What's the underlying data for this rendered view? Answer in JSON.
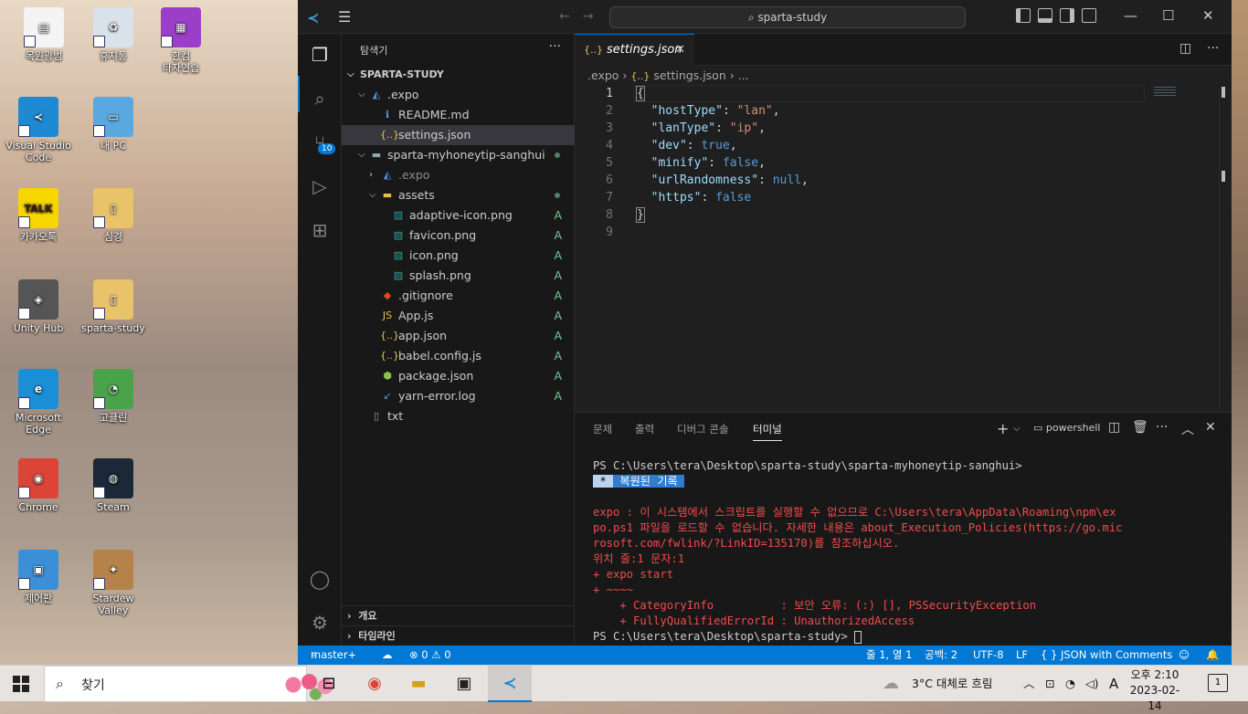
{
  "desktop": {
    "icons": [
      {
        "label": "목원광범",
        "glyph": "▤",
        "color": "#f4f4f4"
      },
      {
        "label": "휴지통",
        "glyph": "♻",
        "color": "#d9e2ea"
      },
      {
        "label": "한컴\n타자연습",
        "glyph": "▦",
        "color": "#9b3fc9"
      },
      {
        "label": "Visual Studio\nCode",
        "glyph": "≺",
        "color": "#1f8ad2"
      },
      {
        "label": "내 PC",
        "glyph": "▭",
        "color": "#5aa8e0"
      },
      {
        "label": "카카오톡",
        "glyph": "TALK",
        "color": "#f7d600"
      },
      {
        "label": "심경",
        "glyph": "▯",
        "color": "#e8c36a"
      },
      {
        "label": "Unity Hub",
        "glyph": "◈",
        "color": "#555"
      },
      {
        "label": "sparta-study",
        "glyph": "▯",
        "color": "#e8c36a"
      },
      {
        "label": "Microsoft\nEdge",
        "glyph": "e",
        "color": "#1b8fd6"
      },
      {
        "label": "고클린",
        "glyph": "◔",
        "color": "#4aa24a"
      },
      {
        "label": "Chrome",
        "glyph": "◉",
        "color": "#db4437"
      },
      {
        "label": "Steam",
        "glyph": "◍",
        "color": "#1b2838"
      },
      {
        "label": "제어판",
        "glyph": "▣",
        "color": "#3a8fd6"
      },
      {
        "label": "Stardew\nValley",
        "glyph": "✦",
        "color": "#b5824a"
      }
    ]
  },
  "titlebar": {
    "search": "sparta-study"
  },
  "activity": {
    "scm_badge": "10"
  },
  "sidebar": {
    "title": "탐색기",
    "more": "···",
    "root": "SPARTA-STUDY",
    "tree": [
      {
        "name": ".expo",
        "type": "folder-open",
        "icon": "◭",
        "icon_color": "#4a90d9",
        "depth": 1,
        "status": ""
      },
      {
        "name": "README.md",
        "type": "file",
        "icon": "ℹ",
        "icon_color": "#4aa3df",
        "depth": 2,
        "status": ""
      },
      {
        "name": "settings.json",
        "type": "file",
        "icon": "{..}",
        "icon_color": "#e8c14c",
        "depth": 2,
        "status": "",
        "selected": true
      },
      {
        "name": "sparta-myhoneytip-sanghui",
        "type": "folder-open",
        "icon": "▬",
        "icon_color": "#90a4ae",
        "depth": 1,
        "status": "dot"
      },
      {
        "name": ".expo",
        "type": "folder-closed",
        "icon": "◭",
        "icon_color": "#4a90d9",
        "depth": 2,
        "status": "",
        "dim": true
      },
      {
        "name": "assets",
        "type": "folder-open",
        "icon": "▬",
        "icon_color": "#e8c14c",
        "depth": 2,
        "status": "dot"
      },
      {
        "name": "adaptive-icon.png",
        "type": "file",
        "icon": "▨",
        "icon_color": "#26a69a",
        "depth": 3,
        "status": "A"
      },
      {
        "name": "favicon.png",
        "type": "file",
        "icon": "▨",
        "icon_color": "#26a69a",
        "depth": 3,
        "status": "A"
      },
      {
        "name": "icon.png",
        "type": "file",
        "icon": "▨",
        "icon_color": "#26a69a",
        "depth": 3,
        "status": "A"
      },
      {
        "name": "splash.png",
        "type": "file",
        "icon": "▨",
        "icon_color": "#26a69a",
        "depth": 3,
        "status": "A"
      },
      {
        "name": ".gitignore",
        "type": "file",
        "icon": "◆",
        "icon_color": "#e64a19",
        "depth": 2,
        "status": "A"
      },
      {
        "name": "App.js",
        "type": "file",
        "icon": "JS",
        "icon_color": "#e8c14c",
        "depth": 2,
        "status": "A"
      },
      {
        "name": "app.json",
        "type": "file",
        "icon": "{..}",
        "icon_color": "#e8c14c",
        "depth": 2,
        "status": "A"
      },
      {
        "name": "babel.config.js",
        "type": "file",
        "icon": "{..}",
        "icon_color": "#e8c14c",
        "depth": 2,
        "status": "A"
      },
      {
        "name": "package.json",
        "type": "file",
        "icon": "⬢",
        "icon_color": "#8bc34a",
        "depth": 2,
        "status": "A"
      },
      {
        "name": "yarn-error.log",
        "type": "file",
        "icon": "↙",
        "icon_color": "#4a90d9",
        "depth": 2,
        "status": "A"
      },
      {
        "name": "txt",
        "type": "file",
        "icon": "▯",
        "icon_color": "#90a4ae",
        "depth": 1,
        "status": ""
      }
    ],
    "outline": "개요",
    "timeline": "타임라인"
  },
  "editor": {
    "tab_icon": "{..}",
    "tab": "settings.json",
    "breadcrumb": [
      ".expo",
      "settings.json",
      "..."
    ],
    "line_numbers": [
      "1",
      "2",
      "3",
      "4",
      "5",
      "6",
      "7",
      "8",
      "9"
    ],
    "code": [
      [
        {
          "t": "p",
          "v": "{"
        }
      ],
      [
        {
          "t": "p",
          "v": "  "
        },
        {
          "t": "k",
          "v": "\"hostType\""
        },
        {
          "t": "p",
          "v": ": "
        },
        {
          "t": "s",
          "v": "\"lan\""
        },
        {
          "t": "p",
          "v": ","
        }
      ],
      [
        {
          "t": "p",
          "v": "  "
        },
        {
          "t": "k",
          "v": "\"lanType\""
        },
        {
          "t": "p",
          "v": ": "
        },
        {
          "t": "s",
          "v": "\"ip\""
        },
        {
          "t": "p",
          "v": ","
        }
      ],
      [
        {
          "t": "p",
          "v": "  "
        },
        {
          "t": "k",
          "v": "\"dev\""
        },
        {
          "t": "p",
          "v": ": "
        },
        {
          "t": "b",
          "v": "true"
        },
        {
          "t": "p",
          "v": ","
        }
      ],
      [
        {
          "t": "p",
          "v": "  "
        },
        {
          "t": "k",
          "v": "\"minify\""
        },
        {
          "t": "p",
          "v": ": "
        },
        {
          "t": "b",
          "v": "false"
        },
        {
          "t": "p",
          "v": ","
        }
      ],
      [
        {
          "t": "p",
          "v": "  "
        },
        {
          "t": "k",
          "v": "\"urlRandomness\""
        },
        {
          "t": "p",
          "v": ": "
        },
        {
          "t": "b",
          "v": "null"
        },
        {
          "t": "p",
          "v": ","
        }
      ],
      [
        {
          "t": "p",
          "v": "  "
        },
        {
          "t": "k",
          "v": "\"https\""
        },
        {
          "t": "p",
          "v": ": "
        },
        {
          "t": "b",
          "v": "false"
        }
      ],
      [
        {
          "t": "p",
          "v": "}"
        }
      ],
      []
    ]
  },
  "panel": {
    "tabs": [
      "문제",
      "출력",
      "디버그 콘솔",
      "터미널"
    ],
    "shell": "powershell",
    "lines": [
      {
        "c": "",
        "v": "PS C:\\Users\\tera\\Desktop\\sparta-study\\sparta-myhoneytip-sanghui>"
      },
      {
        "c": "hl",
        "v": " * ",
        "v2": " 복원된 기록 "
      },
      {
        "c": "",
        "v": " "
      },
      {
        "c": "err",
        "v": "expo : 이 시스템에서 스크립트를 실행할 수 없으므로 C:\\Users\\tera\\AppData\\Roaming\\npm\\ex"
      },
      {
        "c": "err",
        "v": "po.ps1 파일을 로드할 수 없습니다. 자세한 내용은 about_Execution_Policies(https://go.mic"
      },
      {
        "c": "err",
        "v": "rosoft.com/fwlink/?LinkID=135170)를 참조하십시오."
      },
      {
        "c": "err",
        "v": "위치 줄:1 문자:1"
      },
      {
        "c": "err",
        "v": "+ expo start"
      },
      {
        "c": "err",
        "v": "+ ~~~~"
      },
      {
        "c": "err",
        "v": "    + CategoryInfo          : 보안 오류: (:) [], PSSecurityException"
      },
      {
        "c": "err",
        "v": "    + FullyQualifiedErrorId : UnauthorizedAccess"
      },
      {
        "c": "",
        "v": "PS C:\\Users\\tera\\Desktop\\sparta-study> "
      }
    ]
  },
  "statusbar": {
    "branch": "master+",
    "errors": "⊗ 0 ⚠ 0",
    "position": "줄 1, 열 1",
    "spaces": "공백: 2",
    "encoding": "UTF-8",
    "eol": "LF",
    "language": "{ } JSON with Comments"
  },
  "taskbar": {
    "search": "찾기",
    "weather": "3°C  대체로 흐림",
    "ime": "A",
    "time": "오후 2:10",
    "date": "2023-02-14",
    "notifications": "1"
  }
}
